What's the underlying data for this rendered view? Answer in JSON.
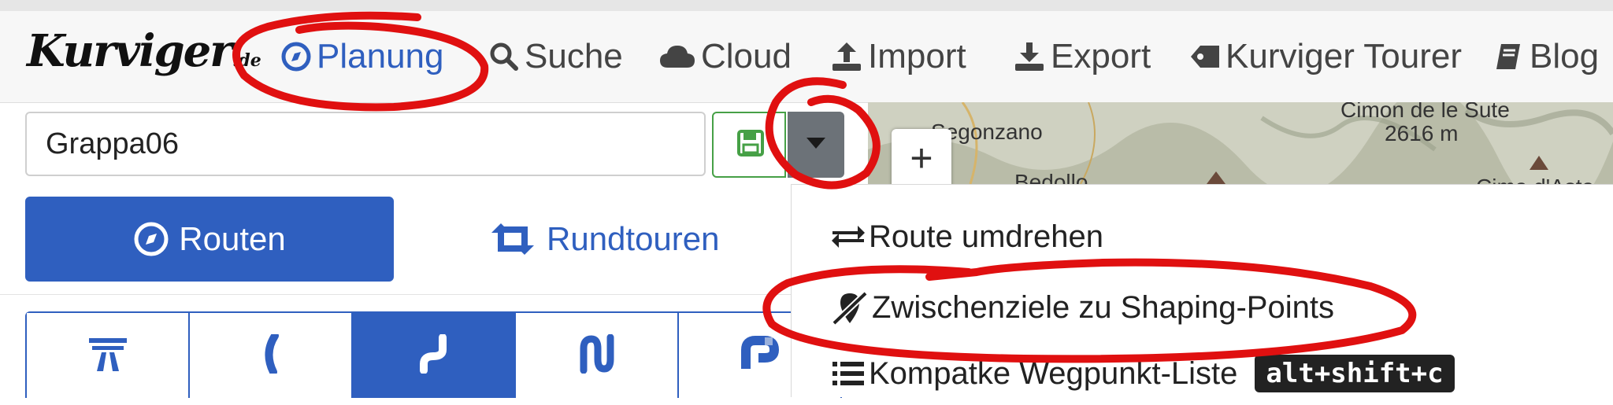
{
  "logo": {
    "main": "Kurviger",
    "tld": ".de"
  },
  "nav": [
    {
      "label": "Planung",
      "icon": "compass-icon",
      "active": true
    },
    {
      "label": "Suche",
      "icon": "search-icon"
    },
    {
      "label": "Cloud",
      "icon": "cloud-icon"
    },
    {
      "label": "Import",
      "icon": "upload-icon"
    },
    {
      "label": "Export",
      "icon": "download-icon"
    },
    {
      "label": "Kurviger Tourer",
      "icon": "tag-icon"
    },
    {
      "label": "Blog",
      "icon": "book-icon"
    }
  ],
  "route": {
    "name": "Grappa06"
  },
  "mode": {
    "routes_label": "Routen",
    "round_label": "Rundtouren"
  },
  "curviness": {
    "active_index": 2,
    "options": [
      "highway-icon",
      "slight-curve-icon",
      "curve-icon",
      "curvier-icon",
      "curviest-icon"
    ]
  },
  "map": {
    "labels": [
      "Segonzano",
      "Bedollo",
      "Cimon de le Sute",
      "2616 m",
      "Cima d'Asta"
    ]
  },
  "menu": {
    "items": [
      {
        "label": "Route umdrehen",
        "icon": "swap-arrows-icon"
      },
      {
        "label": "Zwischenziele zu Shaping-Points",
        "icon": "marker-slash-icon"
      },
      {
        "label": "Kompatke Wegpunkt-Liste",
        "icon": "list-icon",
        "shortcut": "alt+shift+c"
      }
    ]
  },
  "colors": {
    "primary": "#2f5fbf",
    "annotation": "#e01010",
    "save_green": "#46a046"
  }
}
